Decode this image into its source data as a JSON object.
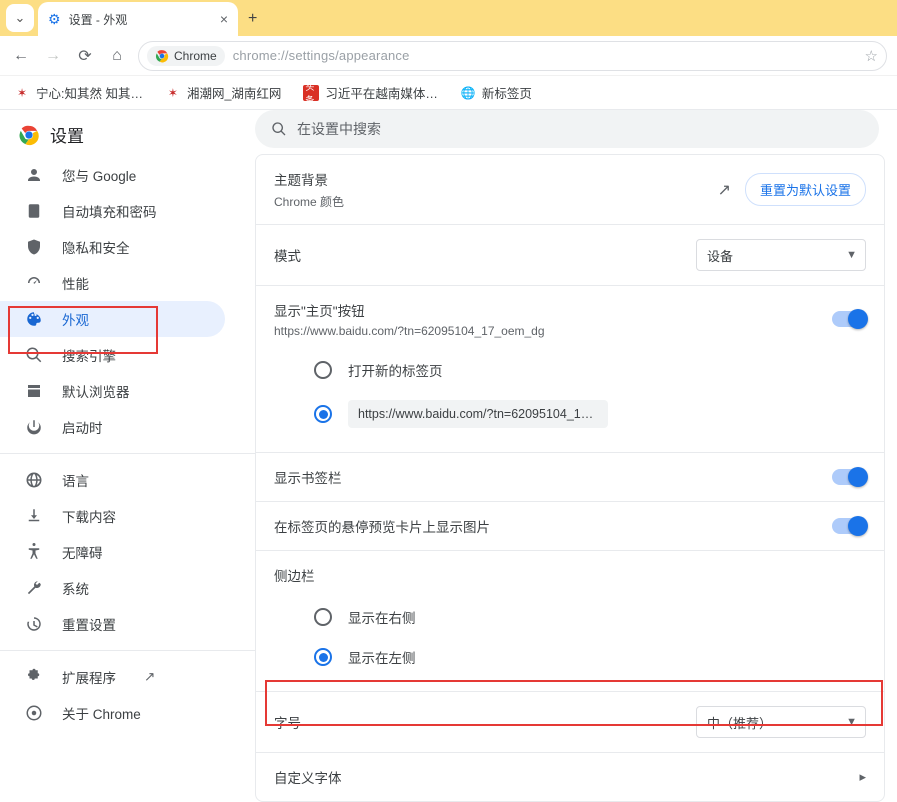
{
  "browser": {
    "tab_title": "设置 - 外观",
    "omnibox": {
      "chip_label": "Chrome",
      "url": "chrome://settings/appearance"
    },
    "bookmarks": [
      {
        "label": "宁心:知其然 知其…"
      },
      {
        "label": "湘潮网_湖南红网"
      },
      {
        "label": "习近平在越南媒体…"
      },
      {
        "label": "新标签页"
      }
    ]
  },
  "settings": {
    "title": "设置",
    "search_placeholder": "在设置中搜索",
    "sidebar": [
      {
        "key": "you-and-google",
        "label": "您与 Google"
      },
      {
        "key": "autofill",
        "label": "自动填充和密码"
      },
      {
        "key": "privacy",
        "label": "隐私和安全"
      },
      {
        "key": "performance",
        "label": "性能"
      },
      {
        "key": "appearance",
        "label": "外观",
        "active": true
      },
      {
        "key": "search-engine",
        "label": "搜索引擎"
      },
      {
        "key": "default-browser",
        "label": "默认浏览器"
      },
      {
        "key": "on-startup",
        "label": "启动时"
      }
    ],
    "sidebar2": [
      {
        "key": "languages",
        "label": "语言"
      },
      {
        "key": "downloads",
        "label": "下载内容"
      },
      {
        "key": "accessibility",
        "label": "无障碍"
      },
      {
        "key": "system",
        "label": "系统"
      },
      {
        "key": "reset",
        "label": "重置设置"
      }
    ],
    "sidebar3": [
      {
        "key": "extensions",
        "label": "扩展程序"
      },
      {
        "key": "about",
        "label": "关于 Chrome"
      }
    ],
    "appearance": {
      "theme_title": "主题背景",
      "theme_sub": "Chrome 颜色",
      "reset_label": "重置为默认设置",
      "mode_label": "模式",
      "mode_value": "设备",
      "home_title": "显示\"主页\"按钮",
      "home_sub": "https://www.baidu.com/?tn=62095104_17_oem_dg",
      "home_radio_newtab": "打开新的标签页",
      "home_radio_url_value": "https://www.baidu.com/?tn=62095104_17_oem...",
      "bookmark_bar_label": "显示书签栏",
      "hover_preview_label": "在标签页的悬停预览卡片上显示图片",
      "sidepanel_label": "侧边栏",
      "sidepanel_right": "显示在右侧",
      "sidepanel_left": "显示在左侧",
      "fontsize_label": "字号",
      "fontsize_value": "中（推荐）",
      "customfont_label": "自定义字体"
    }
  }
}
